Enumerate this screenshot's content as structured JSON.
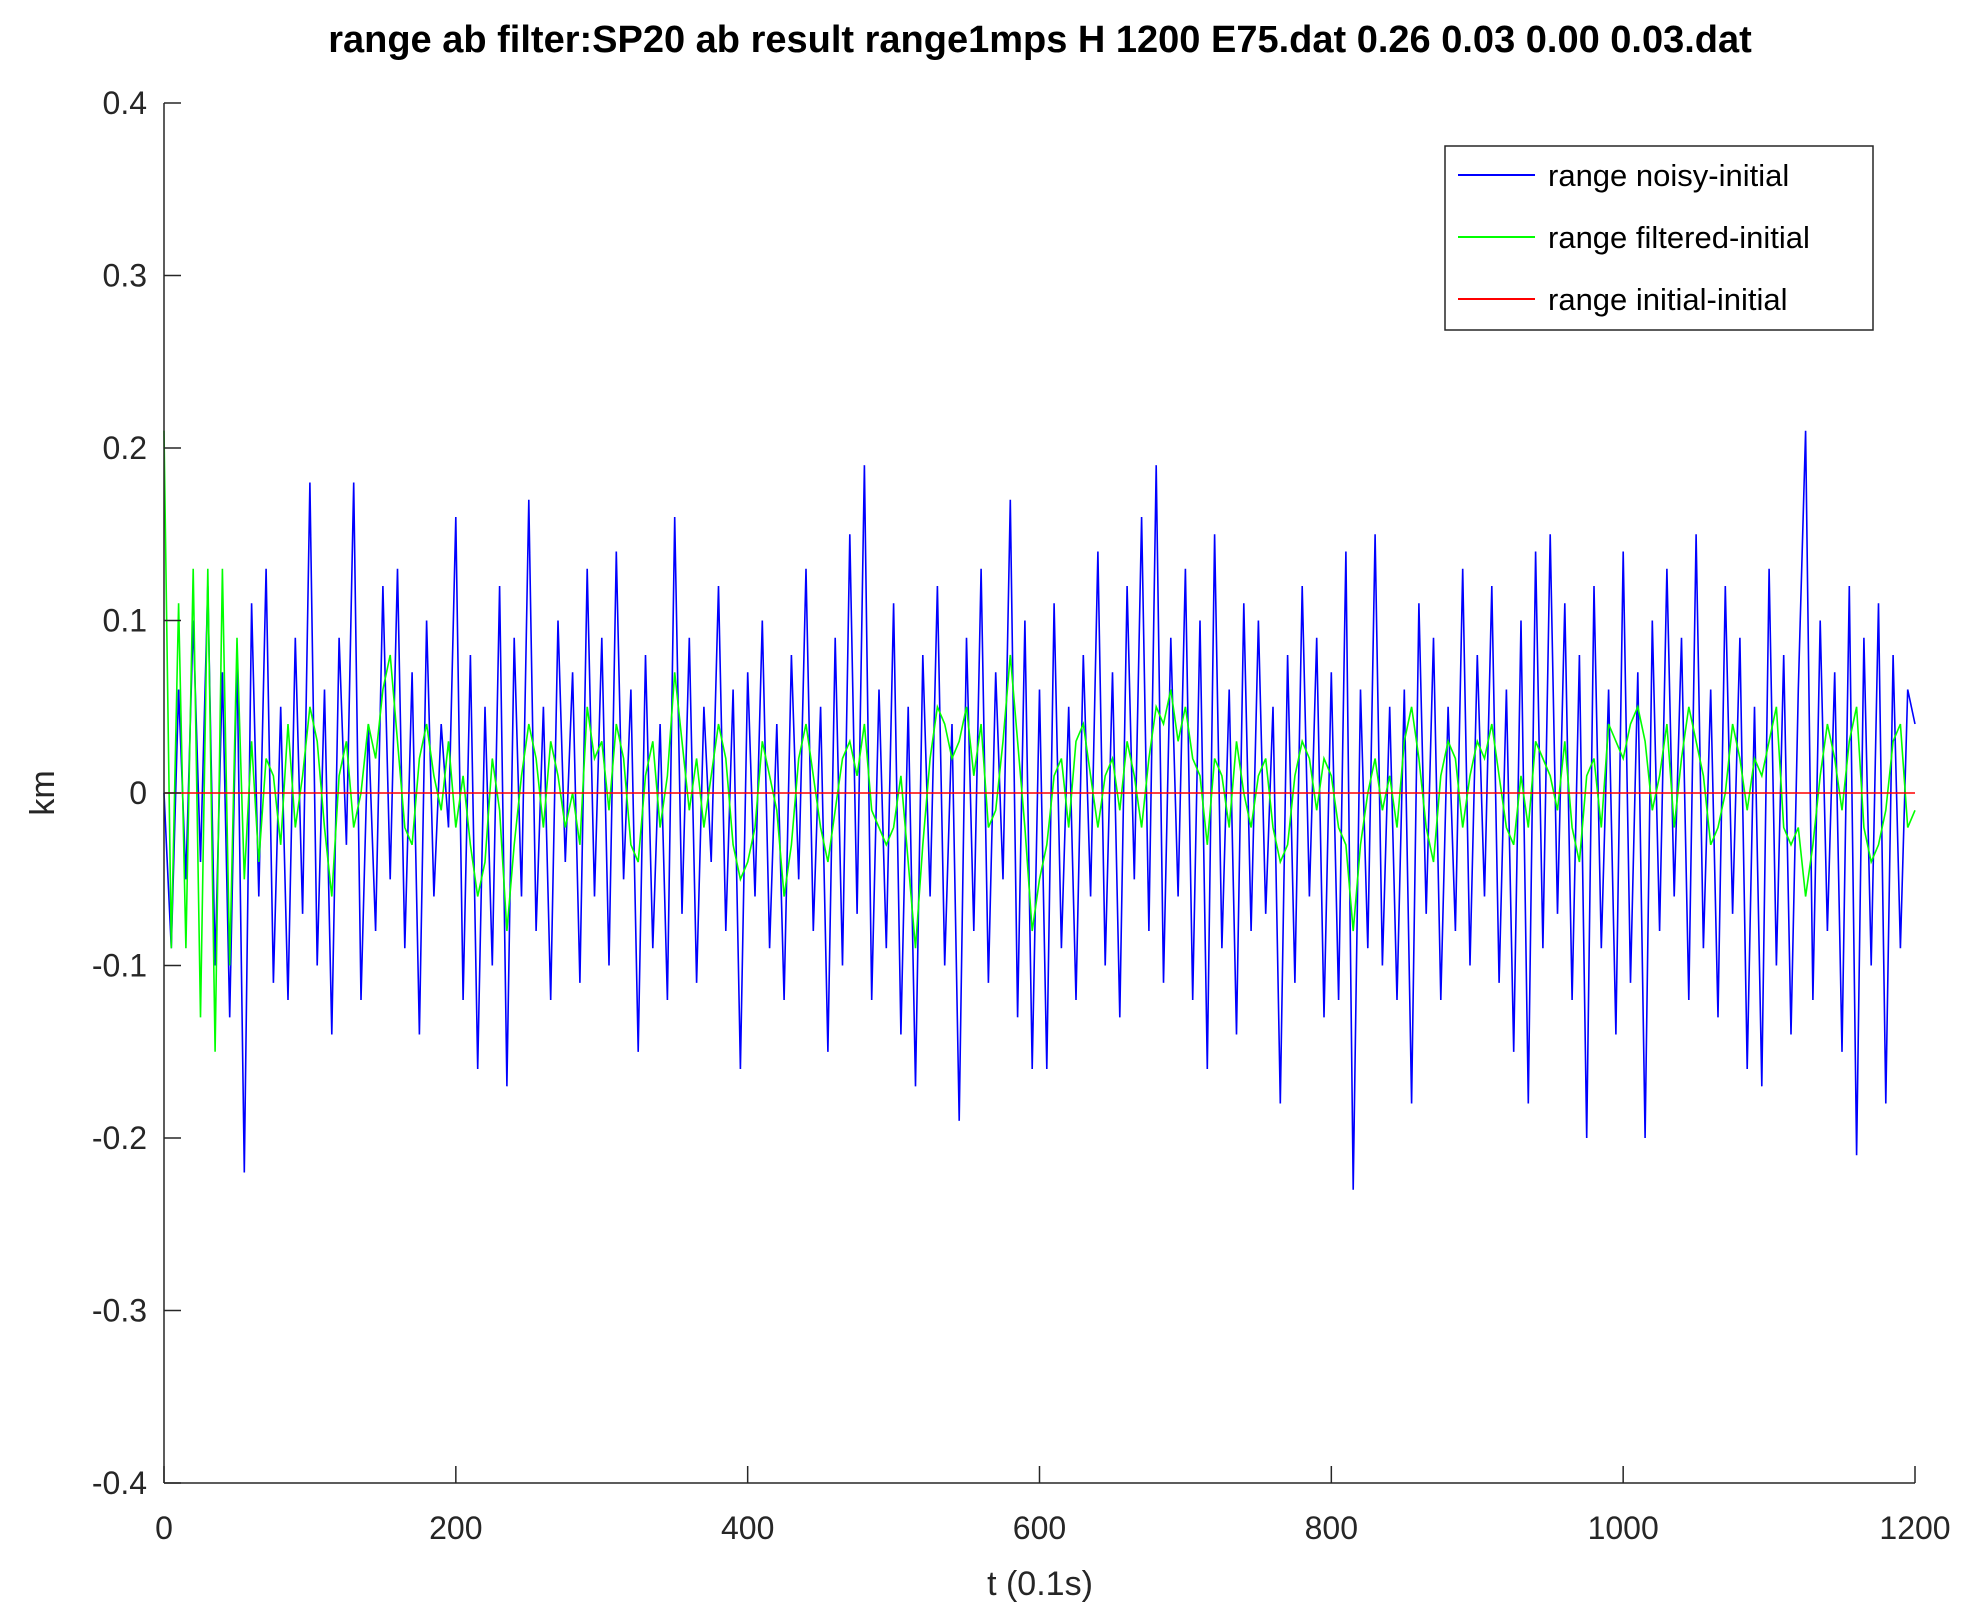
{
  "chart_data": {
    "type": "line",
    "title": "range ab filter:SP20 ab result range1mps H 1200 E75.dat 0.26 0.03 0.00 0.03.dat",
    "xlabel": "t (0.1s)",
    "ylabel": "km",
    "xlim": [
      0,
      1200
    ],
    "ylim": [
      -0.4,
      0.4
    ],
    "xticks": [
      0,
      200,
      400,
      600,
      800,
      1000,
      1200
    ],
    "xtick_labels": [
      "0",
      "200",
      "400",
      "600",
      "800",
      "1000",
      "1200"
    ],
    "yticks": [
      -0.4,
      -0.3,
      -0.2,
      -0.1,
      0,
      0.1,
      0.2,
      0.3,
      0.4
    ],
    "ytick_labels": [
      "-0.4",
      "-0.3",
      "-0.2",
      "-0.1",
      "0",
      "0.1",
      "0.2",
      "0.3",
      "0.4"
    ],
    "grid": false,
    "legend_position": "top-right",
    "x_step": 5,
    "series": [
      {
        "name": "range noisy-initial",
        "color": "#0000ff",
        "values": [
          0.0,
          -0.09,
          0.06,
          -0.05,
          0.1,
          -0.04,
          0.12,
          -0.1,
          0.07,
          -0.13,
          0.08,
          -0.22,
          0.11,
          -0.06,
          0.13,
          -0.11,
          0.05,
          -0.12,
          0.09,
          -0.07,
          0.18,
          -0.1,
          0.06,
          -0.14,
          0.09,
          -0.03,
          0.18,
          -0.12,
          0.04,
          -0.08,
          0.12,
          -0.05,
          0.13,
          -0.09,
          0.07,
          -0.14,
          0.1,
          -0.06,
          0.04,
          -0.02,
          0.16,
          -0.12,
          0.08,
          -0.16,
          0.05,
          -0.1,
          0.12,
          -0.17,
          0.09,
          -0.06,
          0.17,
          -0.08,
          0.05,
          -0.12,
          0.1,
          -0.04,
          0.07,
          -0.11,
          0.13,
          -0.06,
          0.09,
          -0.1,
          0.14,
          -0.05,
          0.06,
          -0.15,
          0.08,
          -0.09,
          0.04,
          -0.12,
          0.16,
          -0.07,
          0.09,
          -0.11,
          0.05,
          -0.04,
          0.12,
          -0.08,
          0.06,
          -0.16,
          0.07,
          -0.06,
          0.1,
          -0.09,
          0.04,
          -0.12,
          0.08,
          -0.05,
          0.13,
          -0.08,
          0.05,
          -0.15,
          0.09,
          -0.1,
          0.15,
          -0.07,
          0.19,
          -0.12,
          0.06,
          -0.09,
          0.11,
          -0.14,
          0.05,
          -0.17,
          0.08,
          -0.06,
          0.12,
          -0.1,
          0.04,
          -0.19,
          0.09,
          -0.08,
          0.13,
          -0.11,
          0.07,
          -0.05,
          0.17,
          -0.13,
          0.1,
          -0.16,
          0.06,
          -0.16,
          0.11,
          -0.09,
          0.05,
          -0.12,
          0.08,
          -0.06,
          0.14,
          -0.1,
          0.07,
          -0.13,
          0.12,
          -0.05,
          0.16,
          -0.08,
          0.19,
          -0.11,
          0.09,
          -0.06,
          0.13,
          -0.12,
          0.1,
          -0.16,
          0.15,
          -0.09,
          0.06,
          -0.14,
          0.11,
          -0.08,
          0.1,
          -0.07,
          0.05,
          -0.18,
          0.08,
          -0.11,
          0.12,
          -0.06,
          0.09,
          -0.13,
          0.07,
          -0.12,
          0.14,
          -0.23,
          0.06,
          -0.09,
          0.15,
          -0.1,
          0.05,
          -0.12,
          0.06,
          -0.18,
          0.11,
          -0.07,
          0.09,
          -0.12,
          0.05,
          -0.08,
          0.13,
          -0.1,
          0.08,
          -0.06,
          0.12,
          -0.11,
          0.06,
          -0.15,
          0.1,
          -0.18,
          0.14,
          -0.09,
          0.15,
          -0.07,
          0.11,
          -0.12,
          0.08,
          -0.2,
          0.12,
          -0.09,
          0.06,
          -0.14,
          0.14,
          -0.11,
          0.07,
          -0.2,
          0.1,
          -0.08,
          0.13,
          -0.06,
          0.09,
          -0.12,
          0.15,
          -0.09,
          0.06,
          -0.13,
          0.12,
          -0.07,
          0.09,
          -0.16,
          0.05,
          -0.17,
          0.13,
          -0.1,
          0.08,
          -0.14,
          0.06,
          0.21,
          -0.12,
          0.1,
          -0.08,
          0.07,
          -0.15,
          0.12,
          -0.21,
          0.09,
          -0.1,
          0.11,
          -0.18,
          0.08,
          -0.09,
          0.06,
          0.04
        ]
      },
      {
        "name": "range filtered-initial",
        "color": "#00ff00",
        "values": [
          0.21,
          -0.09,
          0.11,
          -0.09,
          0.13,
          -0.13,
          0.13,
          -0.15,
          0.13,
          -0.1,
          0.09,
          -0.05,
          0.03,
          -0.04,
          0.02,
          0.01,
          -0.03,
          0.04,
          -0.02,
          0.01,
          0.05,
          0.03,
          -0.02,
          -0.06,
          0.01,
          0.03,
          -0.02,
          0.0,
          0.04,
          0.02,
          0.06,
          0.08,
          0.03,
          -0.02,
          -0.03,
          0.02,
          0.04,
          0.01,
          -0.01,
          0.03,
          -0.02,
          0.01,
          -0.03,
          -0.06,
          -0.04,
          0.02,
          -0.01,
          -0.08,
          -0.03,
          0.01,
          0.04,
          0.02,
          -0.02,
          0.03,
          0.01,
          -0.02,
          0.0,
          -0.03,
          0.05,
          0.02,
          0.03,
          -0.01,
          0.04,
          0.02,
          -0.03,
          -0.04,
          0.01,
          0.03,
          -0.02,
          0.01,
          0.07,
          0.03,
          -0.01,
          0.02,
          -0.02,
          0.01,
          0.04,
          0.02,
          -0.03,
          -0.05,
          -0.04,
          -0.02,
          0.03,
          0.01,
          -0.01,
          -0.06,
          -0.03,
          0.02,
          0.04,
          0.01,
          -0.02,
          -0.04,
          -0.01,
          0.02,
          0.03,
          0.01,
          0.04,
          -0.01,
          -0.02,
          -0.03,
          -0.02,
          0.01,
          -0.04,
          -0.09,
          -0.03,
          0.02,
          0.05,
          0.04,
          0.02,
          0.03,
          0.05,
          0.01,
          0.04,
          -0.02,
          -0.01,
          0.03,
          0.08,
          0.03,
          -0.02,
          -0.08,
          -0.05,
          -0.03,
          0.01,
          0.02,
          -0.02,
          0.03,
          0.04,
          0.01,
          -0.02,
          0.01,
          0.02,
          -0.01,
          0.03,
          0.01,
          -0.02,
          0.02,
          0.05,
          0.04,
          0.06,
          0.03,
          0.05,
          0.02,
          0.01,
          -0.03,
          0.02,
          0.01,
          -0.02,
          0.03,
          0.0,
          -0.02,
          0.01,
          0.02,
          -0.02,
          -0.04,
          -0.03,
          0.01,
          0.03,
          0.02,
          -0.01,
          0.02,
          0.01,
          -0.02,
          -0.03,
          -0.08,
          -0.03,
          0.0,
          0.02,
          -0.01,
          0.01,
          -0.02,
          0.03,
          0.05,
          0.02,
          -0.02,
          -0.04,
          0.01,
          0.03,
          0.02,
          -0.02,
          0.01,
          0.03,
          0.02,
          0.04,
          0.01,
          -0.02,
          -0.03,
          0.01,
          -0.02,
          0.03,
          0.02,
          0.01,
          -0.01,
          0.03,
          -0.02,
          -0.04,
          0.01,
          0.02,
          -0.02,
          0.04,
          0.03,
          0.02,
          0.04,
          0.05,
          0.03,
          -0.01,
          0.01,
          0.04,
          -0.02,
          0.02,
          0.05,
          0.03,
          0.01,
          -0.03,
          -0.02,
          0.0,
          0.04,
          0.02,
          -0.01,
          0.02,
          0.01,
          0.03,
          0.05,
          -0.02,
          -0.03,
          -0.02,
          -0.06,
          -0.03,
          0.01,
          0.04,
          0.02,
          -0.01,
          0.03,
          0.05,
          -0.02,
          -0.04,
          -0.03,
          -0.01,
          0.03,
          0.04,
          -0.02,
          -0.01
        ]
      },
      {
        "name": "range initial-initial",
        "color": "#ff0000",
        "values": [
          0,
          0
        ]
      }
    ]
  }
}
